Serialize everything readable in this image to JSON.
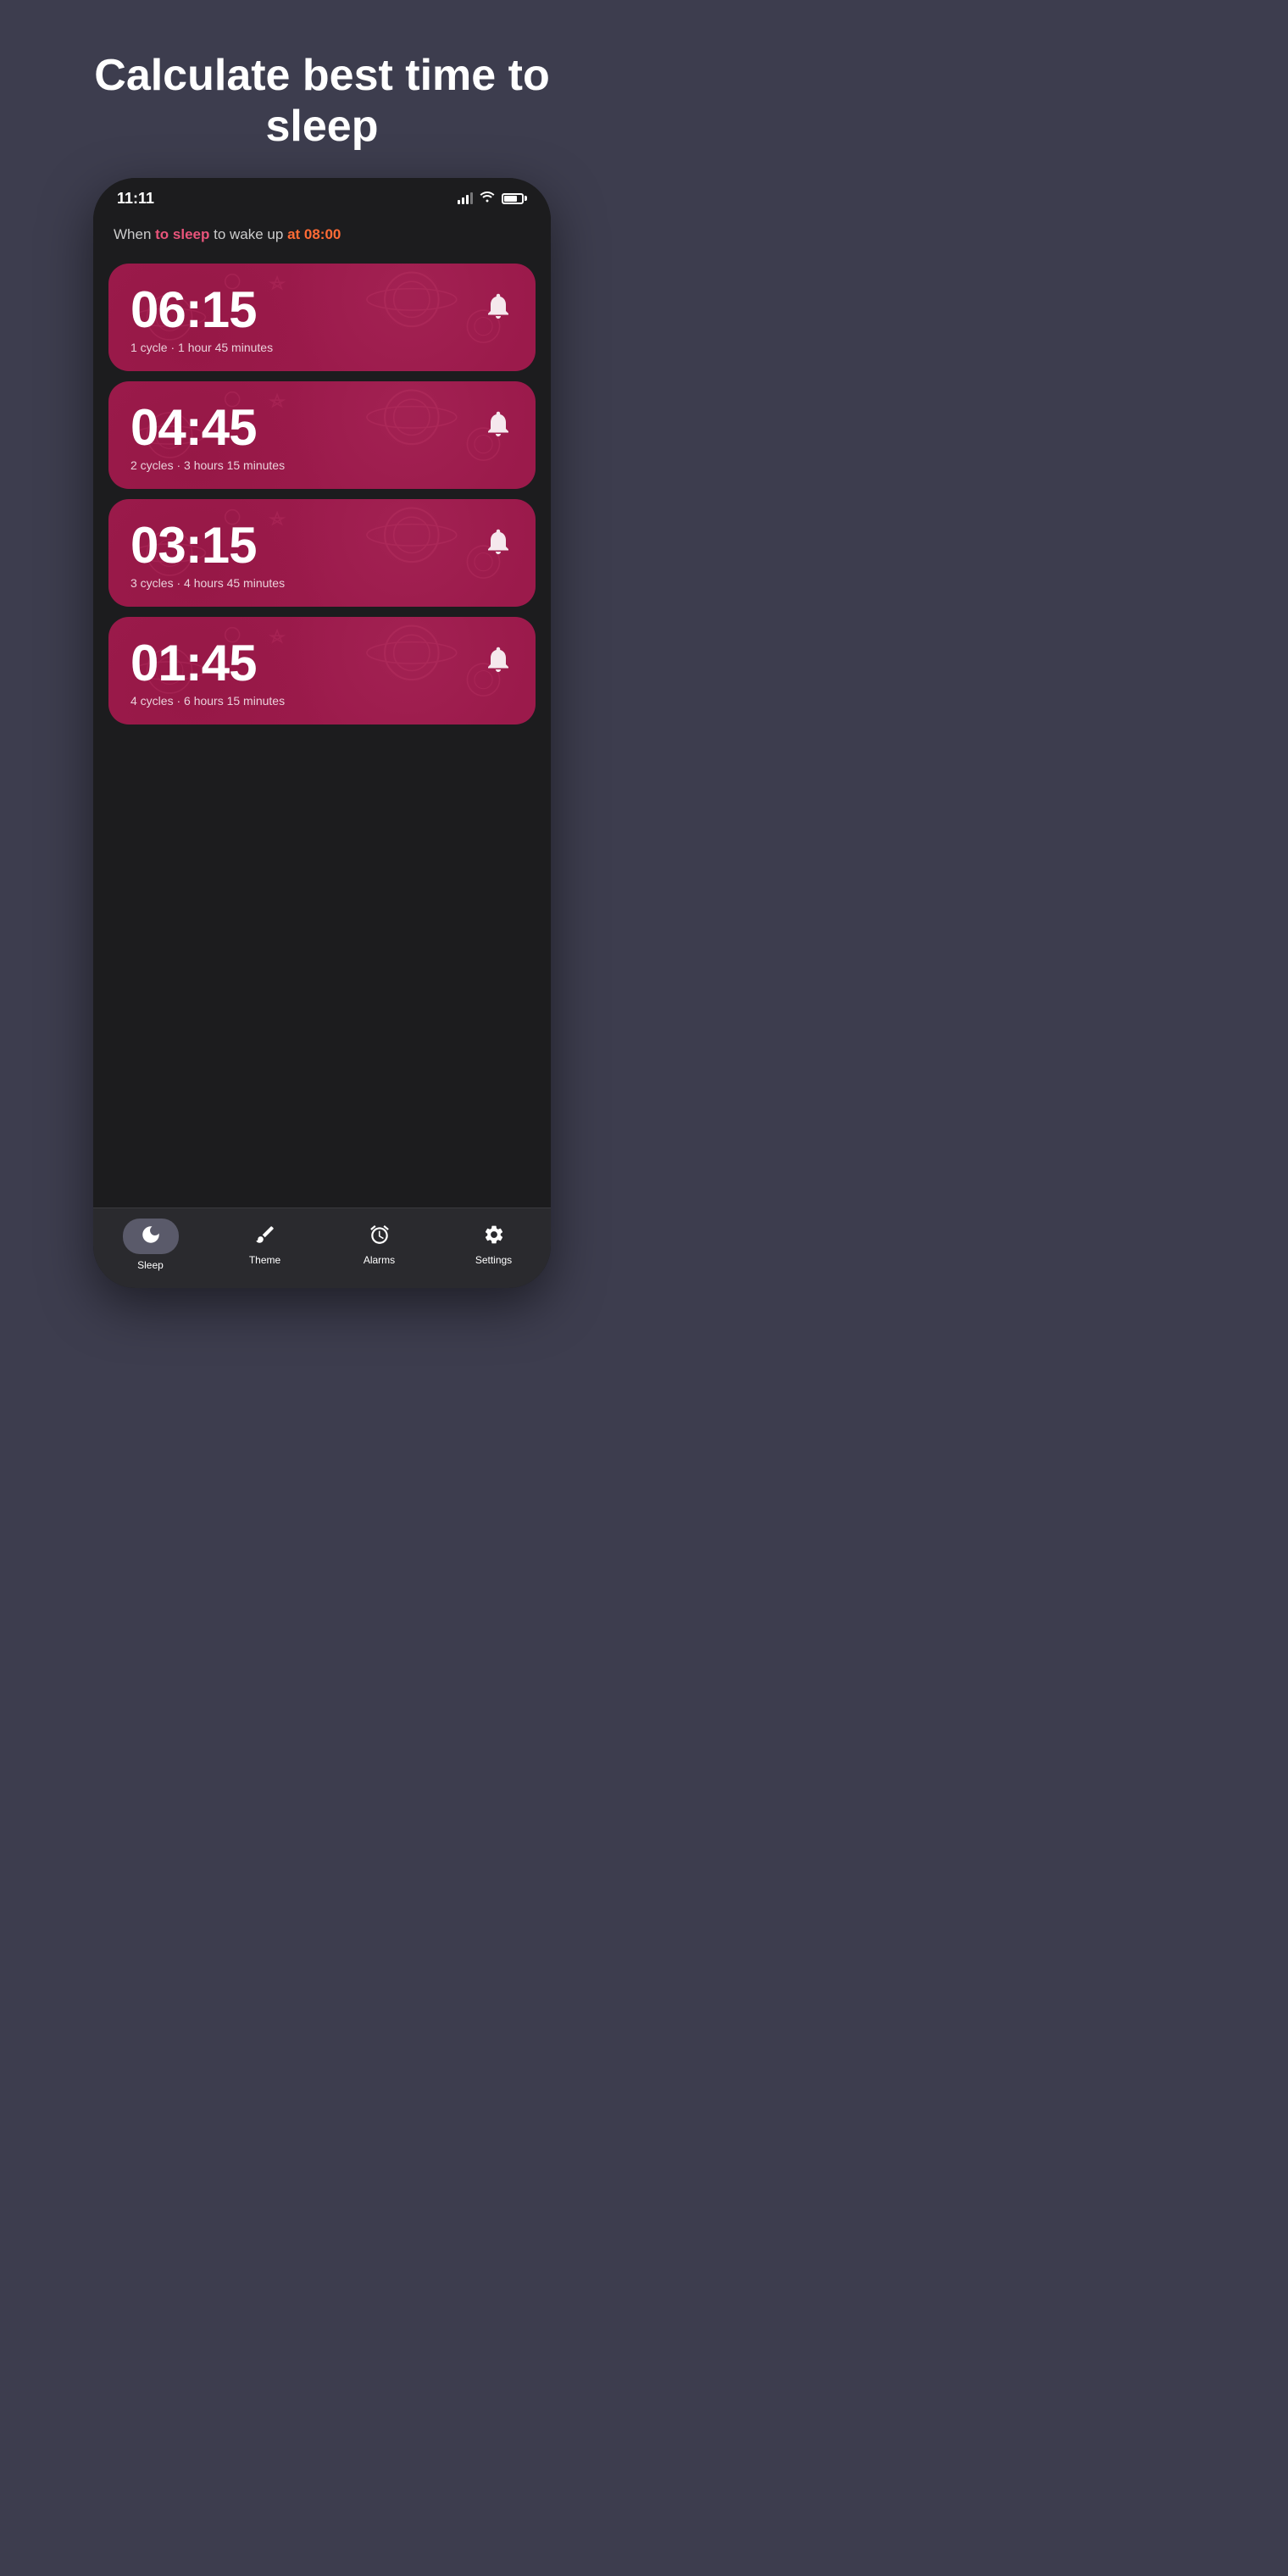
{
  "page": {
    "background_color": "#3d3d4e",
    "title": "Calculate best time to sleep"
  },
  "header": {
    "subtitle_prefix": "When ",
    "subtitle_tosleep": "to sleep",
    "subtitle_middle": " to wake up ",
    "subtitle_time": "at 08:00"
  },
  "status_bar": {
    "time": "11:11"
  },
  "cards": [
    {
      "time": "06:15",
      "cycles_label": "1 cycle · 1 hour 45 minutes"
    },
    {
      "time": "04:45",
      "cycles_label": "2 cycles · 3 hours 15 minutes"
    },
    {
      "time": "03:15",
      "cycles_label": "3 cycles · 4 hours 45 minutes"
    },
    {
      "time": "01:45",
      "cycles_label": "4 cycles · 6 hours 15 minutes"
    }
  ],
  "nav": {
    "items": [
      {
        "id": "sleep",
        "label": "Sleep",
        "icon": "moon",
        "active": true
      },
      {
        "id": "theme",
        "label": "Theme",
        "icon": "brush",
        "active": false
      },
      {
        "id": "alarms",
        "label": "Alarms",
        "icon": "alarm",
        "active": false
      },
      {
        "id": "settings",
        "label": "Settings",
        "icon": "gear",
        "active": false
      }
    ]
  }
}
